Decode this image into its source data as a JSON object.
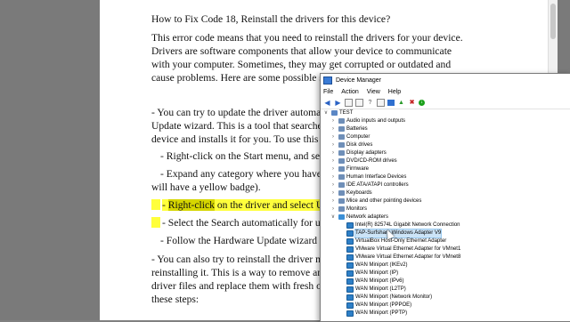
{
  "document": {
    "lines": [
      "How to Fix Code 18, Reinstall the drivers for this device?",
      "This error code means that you need to reinstall the drivers for your device.",
      "Drivers are software components that allow your device to communicate",
      "with your computer. Sometimes, they may get corrupted or outdated and",
      "cause problems. Here are some possible solu",
      "- You can try to update the driver automatic",
      "Update wizard. This is a tool that searches f",
      "device and installs it for you. To use this too",
      "- Right-click on the Start menu, and select",
      "- Expand any category where you have ar",
      "will have a yellow badge).",
      "Right-click",
      " on the driver and select Upd",
      "- Select the Search automatically for upda",
      "- Follow the Hardware Update wizard to c",
      "- You can also try to reinstall the driver man",
      "reinstalling it. This is a way to remove any c",
      "driver files and replace them with fresh ones",
      "these steps:"
    ]
  },
  "device_manager": {
    "title": "Device Manager",
    "menu": [
      "File",
      "Action",
      "View",
      "Help"
    ],
    "root": "TEST",
    "categories": [
      "Audio inputs and outputs",
      "Batteries",
      "Computer",
      "Disk drives",
      "Display adapters",
      "DVD/CD-ROM drives",
      "Firmware",
      "Human Interface Devices",
      "IDE ATA/ATAPI controllers",
      "Keyboards",
      "Mice and other pointing devices",
      "Monitors",
      "Network adapters"
    ],
    "adapters": [
      "Intel(R) 82574L Gigabit Network Connection",
      "TAP-Surfshark Windows Adapter V9",
      "VirtualBox Host-Only Ethernet Adapter",
      "VMware Virtual Ethernet Adapter for VMnet1",
      "VMware Virtual Ethernet Adapter for VMnet8",
      "WAN Miniport (IKEv2)",
      "WAN Miniport (IP)",
      "WAN Miniport (IPv6)",
      "WAN Miniport (L2TP)",
      "WAN Miniport (Network Monitor)",
      "WAN Miniport (PPPOE)",
      "WAN Miniport (PPTP)"
    ]
  }
}
